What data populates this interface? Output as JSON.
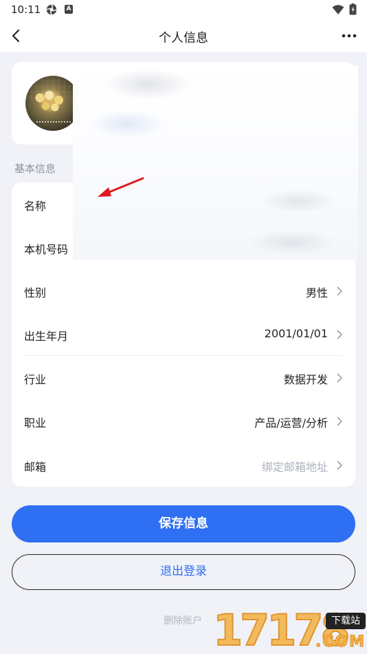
{
  "status_bar": {
    "time": "10:11",
    "a_badge": "A"
  },
  "nav": {
    "title": "个人信息"
  },
  "section": {
    "basic_info_label": "基本信息"
  },
  "info_rows": [
    {
      "label": "名称",
      "value": "",
      "placeholder": false
    },
    {
      "label": "本机号码",
      "value": "",
      "placeholder": false
    },
    {
      "label": "性别",
      "value": "男性",
      "placeholder": false
    },
    {
      "label": "出生年月",
      "value": "2001/01/01",
      "placeholder": false
    },
    {
      "label": "行业",
      "value": "数据开发",
      "placeholder": false
    },
    {
      "label": "职业",
      "value": "产品/运营/分析",
      "placeholder": false
    },
    {
      "label": "邮箱",
      "value": "绑定邮箱地址",
      "placeholder": true
    }
  ],
  "buttons": {
    "save": "保存信息",
    "logout": "退出登录",
    "delete_account": "删除账户"
  },
  "watermark": {
    "digits": "17178",
    "tag": "下载站",
    "com": ".COM"
  },
  "colors": {
    "accent": "#2f6ff3",
    "background": "#f0f2f7",
    "annotation_arrow": "#e0191e"
  },
  "icons": {
    "back": "chevron-left-icon",
    "more": "more-horizontal-icon",
    "camera": "camera-icon",
    "chevron": "chevron-right-icon"
  }
}
